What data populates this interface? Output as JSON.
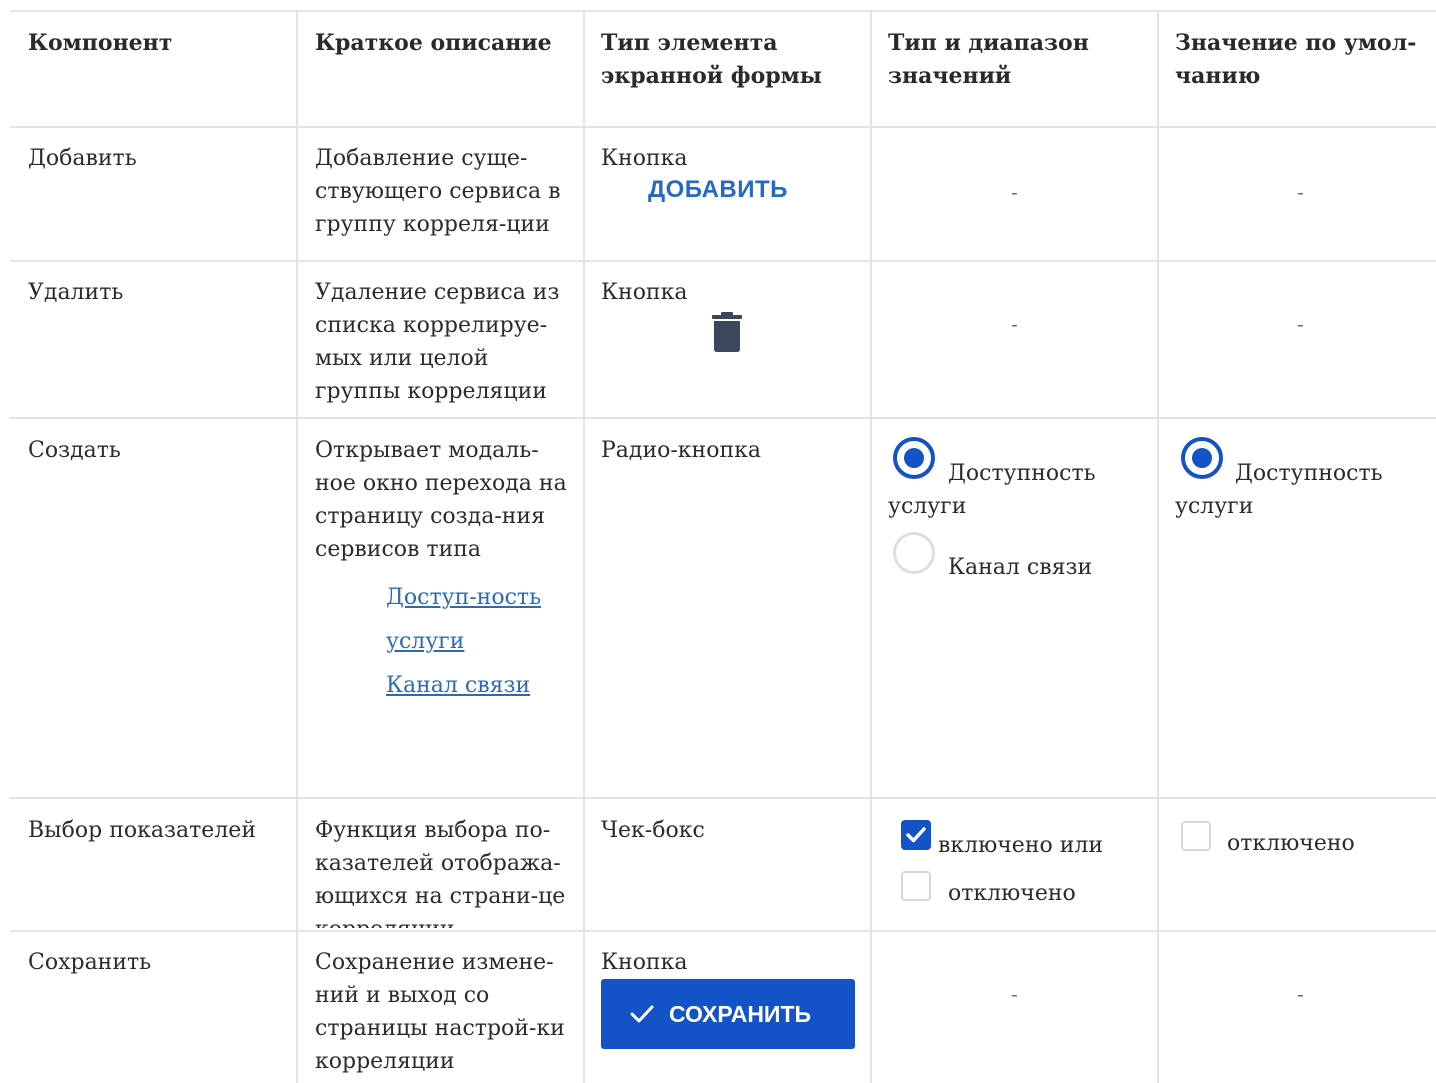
{
  "headers": {
    "component": "Компонент",
    "description": "Краткое описание",
    "element_type": "Тип элемента экранной формы",
    "value_type": "Тип и диапазон значений",
    "default_value": "Значение по умол-чанию"
  },
  "rows": [
    {
      "component": "Добавить",
      "description": "Добавление суще-ствующего сервиса в группу корреля-ции",
      "element_type": "Кнопка",
      "button_label": "ДОБАВИТЬ",
      "value_type": "-",
      "default_value": "-"
    },
    {
      "component": "Удалить",
      "description": "Удаление сервиса из списка коррелируе-мых или целой группы корреляции",
      "element_type": "Кнопка",
      "icon": "trash-icon",
      "value_type": "-",
      "default_value": "-"
    },
    {
      "component": "Создать",
      "description": "Открывает модаль-ное окно перехода на страницу созда-ния сервисов типа",
      "links": [
        "Доступ-ность услуги",
        "Канал связи"
      ],
      "element_type": "Радио-кнопка",
      "options": [
        "Доступность услуги",
        "Канал связи"
      ],
      "default_option": "Доступность услуги"
    },
    {
      "component": "Выбор показателей",
      "description": "Функция выбора по-казателей отобража-ющихся на страни-це корреляции",
      "element_type": "Чек-бокс",
      "options": [
        "включено или",
        "отключено"
      ],
      "default_option": "отключено"
    },
    {
      "component": "Сохранить",
      "description": "Сохранение измене-ний и выход со страницы настрой-ки корреляции",
      "element_type": "Кнопка",
      "button_label": "СОХРАНИТЬ",
      "value_type": "-",
      "default_value": "-"
    }
  ],
  "colors": {
    "accent": "#1452c7",
    "link": "#2a6bb8",
    "grid": "#e4e4e4"
  }
}
